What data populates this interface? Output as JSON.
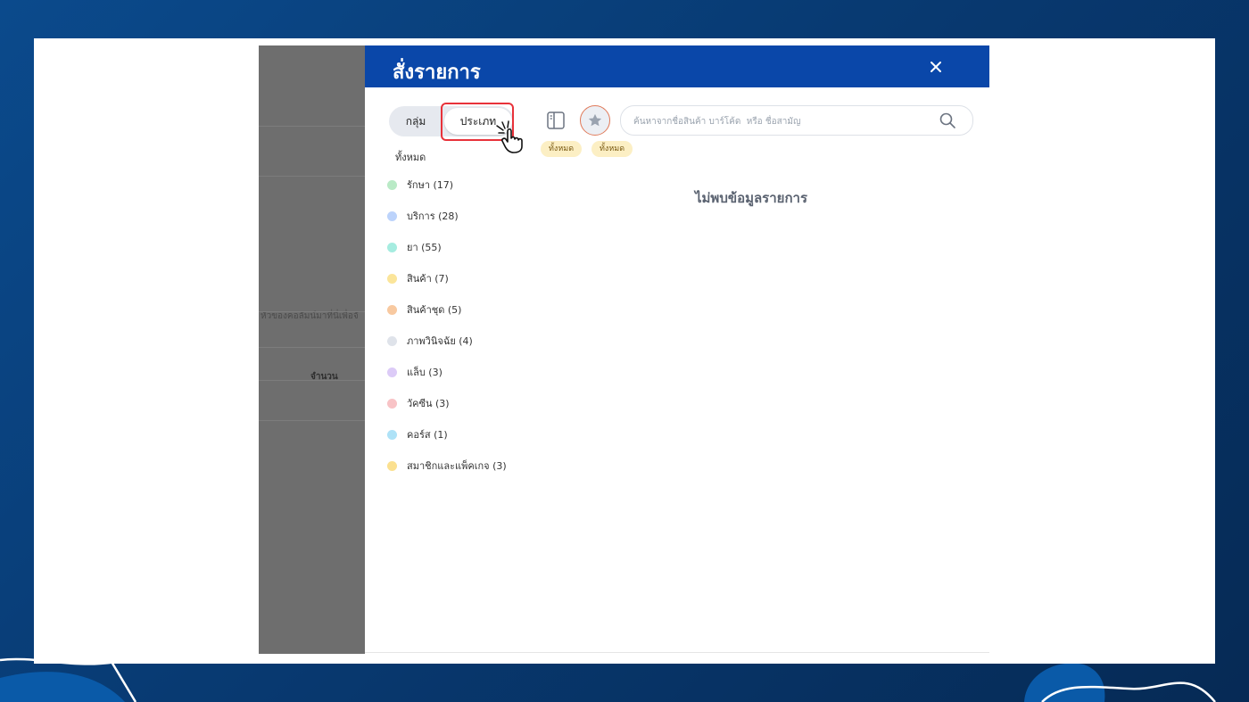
{
  "background": {
    "gradient_start": "#0b4a8c",
    "gradient_end": "#062a55"
  },
  "backdrop": {
    "partial_text": "หัวของคอลัมน์มาที่นี่เพื่อจั",
    "column_header": "จำนวน"
  },
  "modal": {
    "title": "สั่งรายการ",
    "header_color": "#0a47a9",
    "close_icon": "close-icon",
    "tabs": [
      {
        "label": "กลุ่ม",
        "selected": false
      },
      {
        "label": "ประเภท",
        "selected": true
      }
    ],
    "panel_icon": "panel-toggle-icon",
    "favorite_icon": "star-icon",
    "search": {
      "placeholder": "ค้นหาจากชื่อสินค้า บาร์โค้ด  หรือ ชื่อสามัญ",
      "value": "",
      "icon": "search-icon"
    },
    "filter_chips": [
      "ทั้งหมด",
      "ทั้งหมด"
    ],
    "all_label": "ทั้งหมด",
    "categories": [
      {
        "label": "รักษา (17)",
        "color": "#b9eac6"
      },
      {
        "label": "บริการ (28)",
        "color": "#bcd3fb"
      },
      {
        "label": "ยา (55)",
        "color": "#a6ece0"
      },
      {
        "label": "สินค้า (7)",
        "color": "#fbe59a"
      },
      {
        "label": "สินค้าชุด (5)",
        "color": "#f8c9a0"
      },
      {
        "label": "ภาพวินิจฉัย (4)",
        "color": "#dfe3ea"
      },
      {
        "label": "แล็บ (3)",
        "color": "#dccbf7"
      },
      {
        "label": "วัคซีน (3)",
        "color": "#f8c3c6"
      },
      {
        "label": "คอร์ส (1)",
        "color": "#aee2f7"
      },
      {
        "label": "สมาชิกและแพ็คเกจ (3)",
        "color": "#fbe08f"
      }
    ],
    "empty_message": "ไม่พบข้อมูลรายการ"
  },
  "annotation": {
    "highlight_color": "#e8323a",
    "pointer_icon": "hand-pointer-icon"
  }
}
